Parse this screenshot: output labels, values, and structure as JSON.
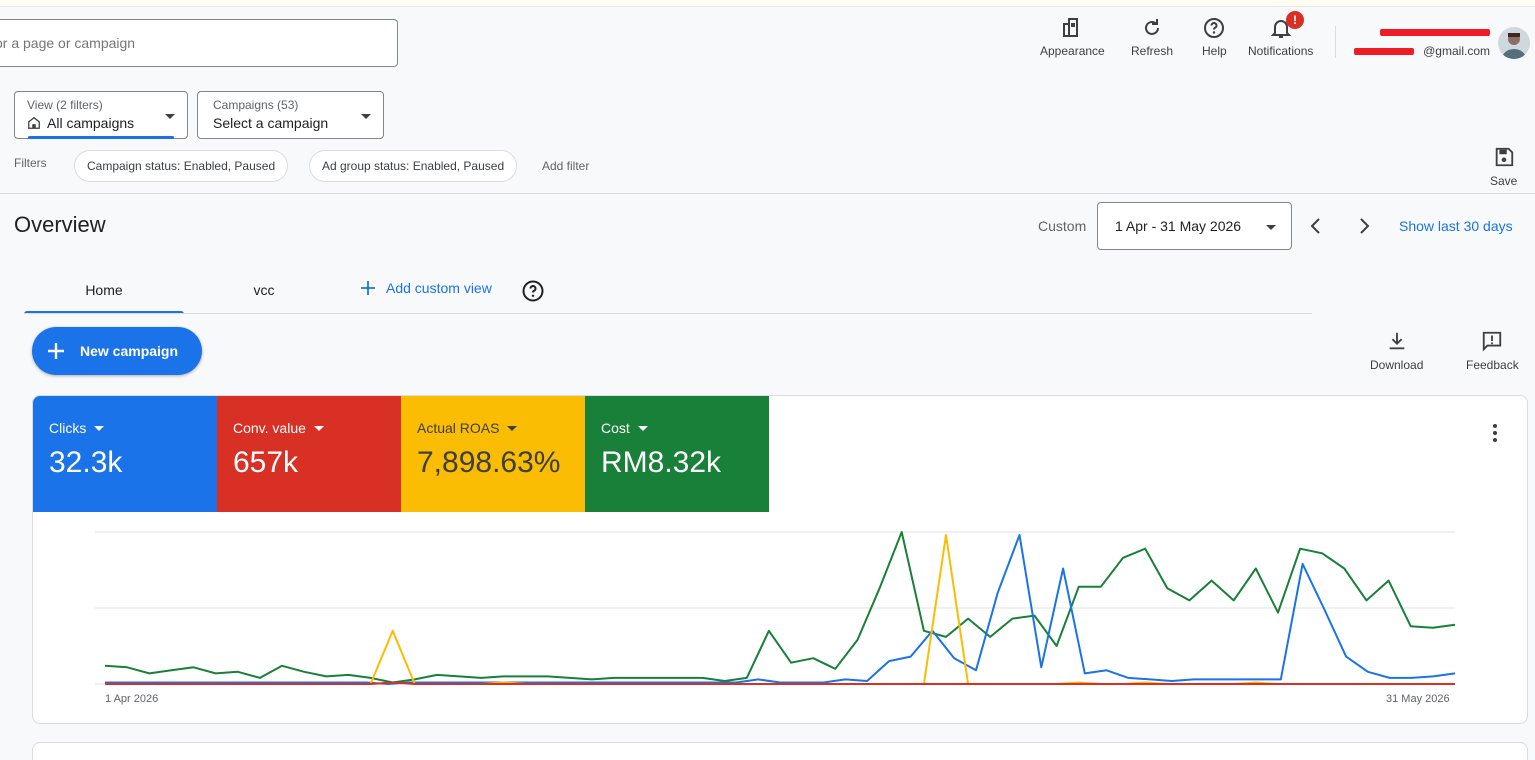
{
  "search": {
    "placeholder": "or a page or campaign"
  },
  "toolbar": {
    "appearance_label": "Appearance",
    "refresh_label": "Refresh",
    "help_label": "Help",
    "notifications_label": "Notifications",
    "notifications_badge": "!"
  },
  "account": {
    "email_suffix": "@gmail.com"
  },
  "view_dropdown": {
    "caption": "View (2 filters)",
    "value": "All campaigns"
  },
  "campaign_dropdown": {
    "caption": "Campaigns (53)",
    "value": "Select a campaign"
  },
  "filters": {
    "label": "Filters",
    "chips": [
      "Campaign status: Enabled, Paused",
      "Ad group status: Enabled, Paused"
    ],
    "add_filter": "Add filter",
    "save_label": "Save"
  },
  "overview": {
    "title": "Overview",
    "date_mode": "Custom",
    "date_range": "1 Apr - 31 May 2026",
    "show_last": "Show last 30 days"
  },
  "tabs": [
    {
      "label": "Home",
      "active": true
    },
    {
      "label": "vcc",
      "active": false
    }
  ],
  "add_custom_view": "Add custom view",
  "new_campaign": "New campaign",
  "actions": {
    "download_label": "Download",
    "feedback_label": "Feedback"
  },
  "metrics": [
    {
      "label": "Clicks",
      "value": "32.3k",
      "color": "#1a73e8",
      "text_color": "#ffffff"
    },
    {
      "label": "Conv. value",
      "value": "657k",
      "color": "#d93025",
      "text_color": "#ffffff"
    },
    {
      "label": "Actual ROAS",
      "value": "7,898.63%",
      "color": "#fbbc04",
      "text_color": "#3c4043"
    },
    {
      "label": "Cost",
      "value": "RM8.32k",
      "color": "#188038",
      "text_color": "#ffffff"
    }
  ],
  "chart_data": {
    "type": "line",
    "x_start_label": "1 Apr 2026",
    "x_end_label": "31 May 2026",
    "grid": true,
    "ylim": [
      0,
      100
    ],
    "series": [
      {
        "color": "#188038",
        "values": [
          12,
          11,
          7,
          9,
          11,
          7,
          8,
          4,
          12,
          8,
          5,
          6,
          4,
          1,
          3,
          6,
          5,
          4,
          5,
          5,
          5,
          4,
          3,
          4,
          4,
          4,
          4,
          4,
          2,
          4,
          35,
          14,
          17,
          10,
          29,
          63,
          100,
          35,
          31,
          43,
          31,
          43,
          45,
          25,
          64,
          64,
          83,
          89,
          63,
          55,
          68,
          55,
          76,
          47,
          89,
          86,
          76,
          55,
          68,
          38,
          37,
          39
        ]
      },
      {
        "color": "#1a73e8",
        "values": [
          1,
          1,
          1,
          1,
          1,
          1,
          1,
          1,
          1,
          1,
          1,
          1,
          1,
          0,
          1,
          1,
          1,
          1,
          1,
          1,
          1,
          1,
          1,
          1,
          1,
          1,
          1,
          1,
          1,
          1,
          3,
          1,
          1,
          1,
          3,
          2,
          15,
          18,
          35,
          17,
          9,
          60,
          98,
          11,
          76,
          7,
          9,
          4,
          3,
          2,
          3,
          3,
          3,
          3,
          3,
          79,
          49,
          18,
          8,
          4,
          4,
          5,
          7
        ]
      },
      {
        "color": "#fbbc04",
        "values": [
          0,
          0,
          0,
          0,
          0,
          0,
          0,
          0,
          0,
          0,
          0,
          0,
          0,
          35,
          0,
          0,
          0,
          0,
          1,
          0,
          0,
          0,
          0,
          0,
          0,
          0,
          0,
          0,
          0,
          0,
          0,
          0,
          0,
          0,
          0,
          0,
          0,
          0,
          98,
          0,
          0,
          0,
          0,
          0,
          1,
          0,
          0,
          1,
          0,
          0,
          0,
          0,
          1,
          0,
          0,
          0,
          0,
          0,
          0,
          0,
          0,
          0
        ]
      },
      {
        "color": "#d93025",
        "values": [
          0,
          0,
          0,
          0,
          0,
          0,
          0,
          0,
          0,
          0,
          0,
          0,
          0,
          1,
          0,
          0,
          0,
          0,
          0,
          0,
          0,
          0,
          0,
          0,
          0,
          0,
          0,
          0,
          0,
          0,
          0,
          0,
          0,
          0,
          0,
          0,
          0,
          0,
          0,
          0,
          0,
          0,
          0,
          0,
          0,
          0,
          0,
          0,
          0,
          0,
          0,
          0,
          0,
          0,
          0,
          0,
          0,
          0,
          0,
          0,
          0,
          0
        ]
      }
    ]
  }
}
